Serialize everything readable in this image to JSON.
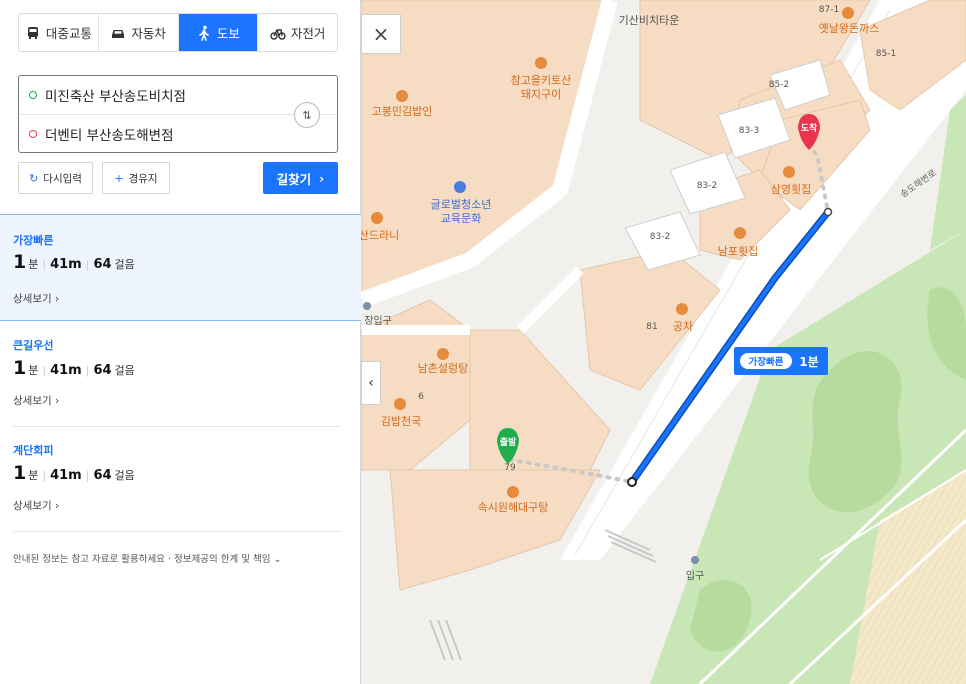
{
  "modes": [
    {
      "label": "대중교통",
      "icon": "bus-icon"
    },
    {
      "label": "자동차",
      "icon": "car-icon"
    },
    {
      "label": "도보",
      "icon": "walk-icon",
      "active": true
    },
    {
      "label": "자전거",
      "icon": "bicycle-icon"
    }
  ],
  "search": {
    "origin": "미진축산 부산송도비치점",
    "destination": "더벤티 부산송도해변점"
  },
  "actions": {
    "reset_label": "다시입력",
    "waypoint_label": "경유지",
    "find_label": "길찾기",
    "find_arrow": "›"
  },
  "routes": [
    {
      "title": "가장빠른",
      "minutes": "1",
      "minute_unit": "분",
      "distance": "41m",
      "steps": "64",
      "step_unit": "걸음",
      "detail": "상세보기 ›"
    },
    {
      "title": "큰길우선",
      "minutes": "1",
      "minute_unit": "분",
      "distance": "41m",
      "steps": "64",
      "step_unit": "걸음",
      "detail": "상세보기 ›"
    },
    {
      "title": "계단회피",
      "minutes": "1",
      "minute_unit": "분",
      "distance": "41m",
      "steps": "64",
      "step_unit": "걸음",
      "detail": "상세보기 ›"
    }
  ],
  "notice": "안내된 정보는 참고 자료로 활용하세요 · 정보제공의 한계 및 책임 ⌄",
  "map": {
    "close_icon": "×",
    "collapse_icon": "‹",
    "route_badge": {
      "tag": "가장빠른",
      "time": "1분"
    },
    "start_label": "출발",
    "end_label": "도착",
    "road_label": "송도해변로",
    "places": [
      {
        "name": "기산비치타운"
      },
      {
        "name": "87-1"
      },
      {
        "name": "옛날왕돈까스"
      },
      {
        "name": "85-1"
      },
      {
        "name": "85-2"
      },
      {
        "name": "참고을키토산"
      },
      {
        "name": "돼지구이"
      },
      {
        "name": "고봉민김밥인"
      },
      {
        "name": "83-3"
      },
      {
        "name": "삼영횟집"
      },
      {
        "name": "83-2"
      },
      {
        "name": "83-2"
      },
      {
        "name": "글로벌청소년"
      },
      {
        "name": "교육문화"
      },
      {
        "name": "남포횟집"
      },
      {
        "name": "산드라니"
      },
      {
        "name": "장입구"
      },
      {
        "name": "81"
      },
      {
        "name": "공차"
      },
      {
        "name": "남촌설렁탕"
      },
      {
        "name": "6"
      },
      {
        "name": "김밥천국"
      },
      {
        "name": "79"
      },
      {
        "name": "속시원해대구탕"
      },
      {
        "name": "입구"
      }
    ]
  },
  "colors": {
    "accent": "#1a74ff",
    "route_line": "#0a63d8",
    "building": "#f6dcc3",
    "green": "#c7e4b5",
    "start_marker": "#1fae4b",
    "end_marker": "#e8344c",
    "poi": "#e68a3c"
  }
}
